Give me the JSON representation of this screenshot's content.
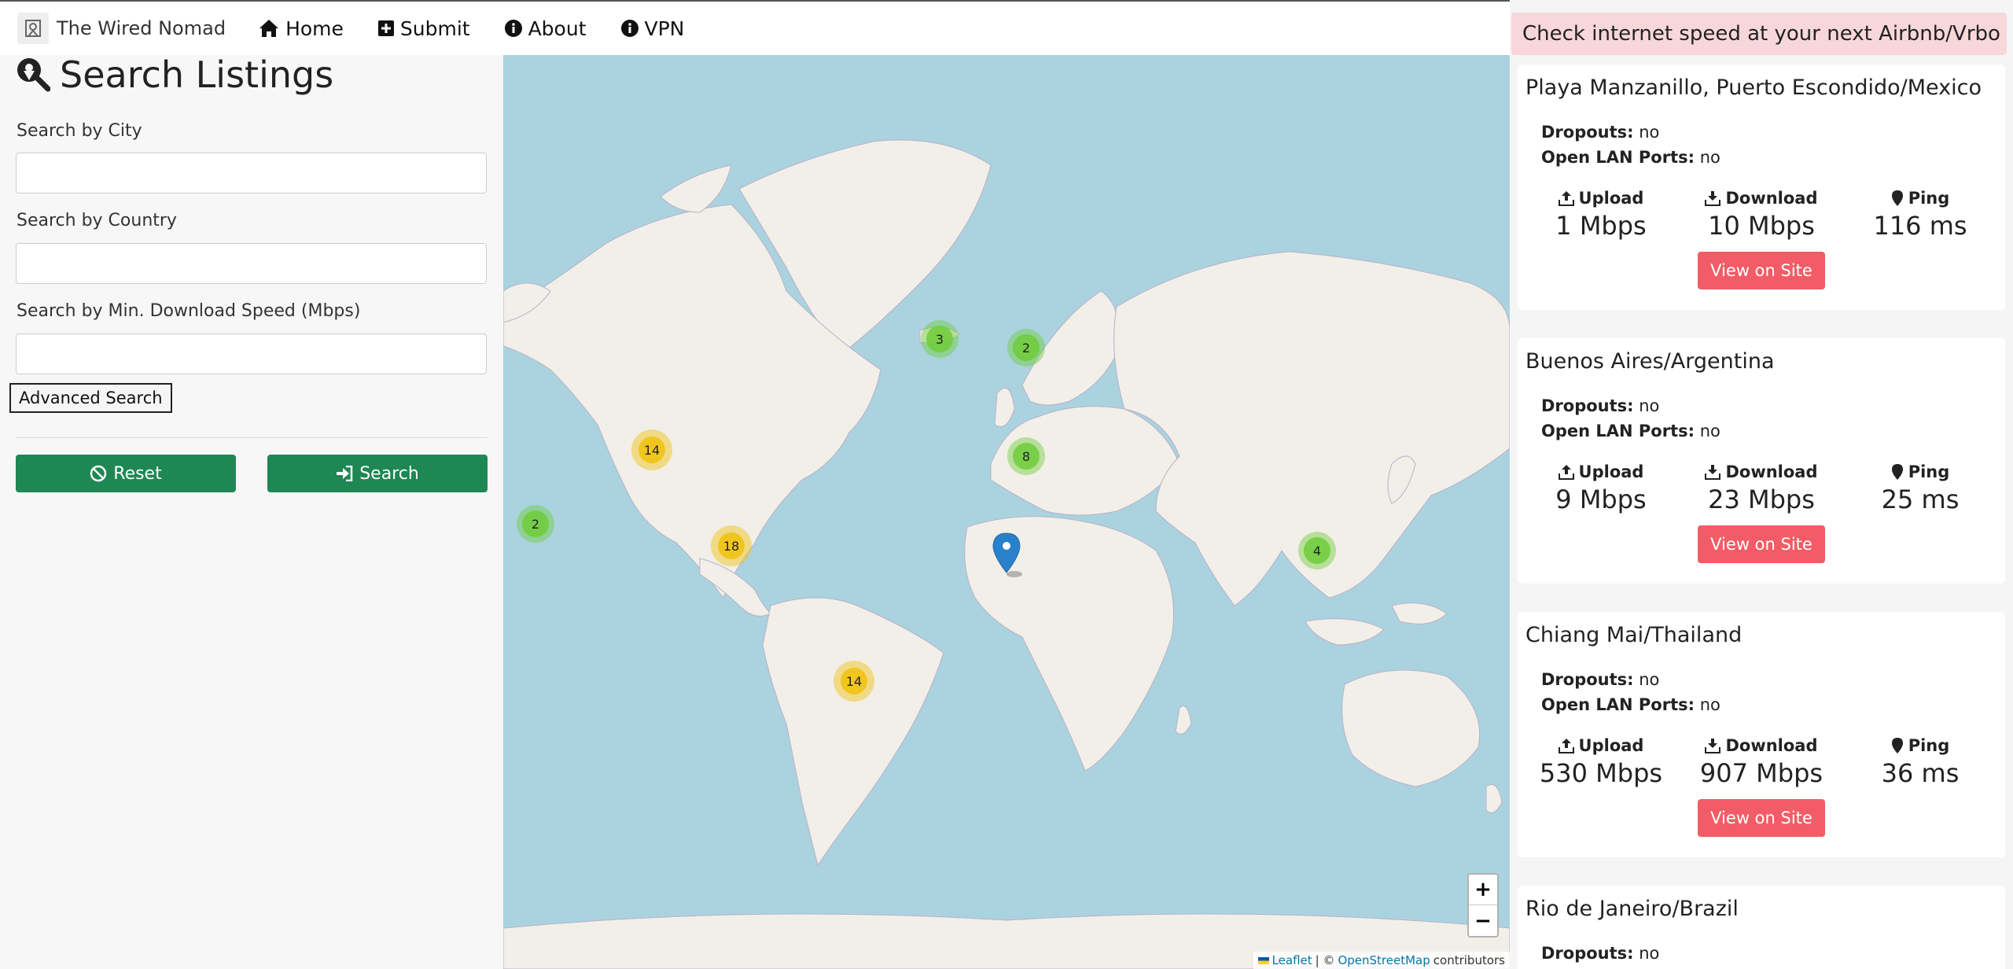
{
  "nav": {
    "brand": "The Wired Nomad",
    "items": [
      {
        "label": "Home",
        "icon": "home-icon"
      },
      {
        "label": "Submit",
        "icon": "plus-square-icon"
      },
      {
        "label": "About",
        "icon": "info-circle-icon"
      },
      {
        "label": "VPN",
        "icon": "info-circle-icon"
      }
    ]
  },
  "search": {
    "title": "Search Listings",
    "city_label": "Search by City",
    "city_value": "",
    "country_label": "Search by Country",
    "country_value": "",
    "speed_label": "Search by Min. Download Speed (Mbps)",
    "speed_value": "",
    "advanced_label": "Advanced Search",
    "reset_label": "Reset",
    "search_label": "Search"
  },
  "map": {
    "clusters": [
      {
        "count": "3",
        "level": "green"
      },
      {
        "count": "2",
        "level": "green"
      },
      {
        "count": "14",
        "level": "yellow"
      },
      {
        "count": "8",
        "level": "green"
      },
      {
        "count": "2",
        "level": "green"
      },
      {
        "count": "18",
        "level": "yellow"
      },
      {
        "count": "4",
        "level": "green"
      },
      {
        "count": "14",
        "level": "yellow"
      }
    ],
    "zoom_in": "+",
    "zoom_out": "−",
    "attribution": {
      "leaflet": "Leaflet",
      "separator": "| ©",
      "osm": "OpenStreetMap",
      "contributors": "contributors"
    }
  },
  "listings": {
    "banner": "Check internet speed at your next Airbnb/Vrbo",
    "labels": {
      "dropouts": "Dropouts:",
      "lan": "Open LAN Ports:",
      "upload": "Upload",
      "download": "Download",
      "ping": "Ping",
      "view": "View on Site"
    },
    "items": [
      {
        "title": "Playa Manzanillo, Puerto Escondido/Mexico",
        "dropouts": "no",
        "lan": "no",
        "upload": "1 Mbps",
        "download": "10 Mbps",
        "ping": "116 ms"
      },
      {
        "title": "Buenos Aires/Argentina",
        "dropouts": "no",
        "lan": "no",
        "upload": "9 Mbps",
        "download": "23 Mbps",
        "ping": "25 ms"
      },
      {
        "title": "Chiang Mai/Thailand",
        "dropouts": "no",
        "lan": "no",
        "upload": "530 Mbps",
        "download": "907 Mbps",
        "ping": "36 ms"
      },
      {
        "title": "Rio de Janeiro/Brazil",
        "dropouts": "no"
      }
    ]
  },
  "colors": {
    "green_button": "#1e8753",
    "view_button": "#f25c66",
    "banner_bg": "#f8d7da",
    "ocean": "#aad3df",
    "land": "#f2efe9"
  }
}
